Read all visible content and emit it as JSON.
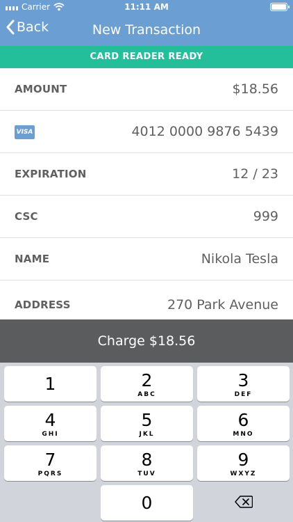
{
  "status_bar": {
    "carrier": "Carrier",
    "time": "11:11 AM"
  },
  "nav": {
    "back_label": "Back",
    "title": "New Transaction"
  },
  "banner": {
    "text": "CARD READER READY"
  },
  "form": {
    "amount": {
      "label": "AMOUNT",
      "value": "$18.56"
    },
    "card": {
      "brand": "VISA",
      "number": "4012 0000 9876 5439"
    },
    "expiration": {
      "label": "EXPIRATION",
      "value": "12 / 23"
    },
    "csc": {
      "label": "CSC",
      "value": "999"
    },
    "name": {
      "label": "NAME",
      "value": "Nikola Tesla"
    },
    "address": {
      "label": "ADDRESS",
      "value": "270 Park Avenue"
    }
  },
  "charge_button": {
    "label": "Charge $18.56"
  },
  "keypad": {
    "keys": [
      {
        "digit": "1",
        "letters": ""
      },
      {
        "digit": "2",
        "letters": "ABC"
      },
      {
        "digit": "3",
        "letters": "DEF"
      },
      {
        "digit": "4",
        "letters": "GHI"
      },
      {
        "digit": "5",
        "letters": "JKL"
      },
      {
        "digit": "6",
        "letters": "MNO"
      },
      {
        "digit": "7",
        "letters": "PQRS"
      },
      {
        "digit": "8",
        "letters": "TUV"
      },
      {
        "digit": "9",
        "letters": "WXYZ"
      },
      {
        "digit": "0",
        "letters": ""
      }
    ],
    "delete_icon": "backspace-icon"
  },
  "colors": {
    "nav_bar": "#6b9fd3",
    "banner": "#23bf9b",
    "charge_button": "#5b5c5e",
    "keypad_bg": "#d1d4da",
    "text": "#606060"
  }
}
